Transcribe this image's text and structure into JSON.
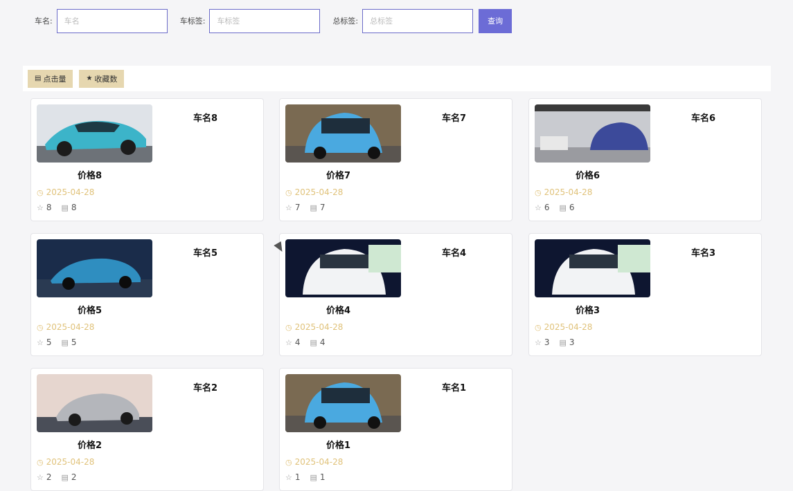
{
  "search": {
    "car_name_label": "车名:",
    "car_name_placeholder": "车名",
    "car_tag_label": "车标签:",
    "car_tag_placeholder": "车标签",
    "total_tag_label": "总标签:",
    "total_tag_placeholder": "总标签",
    "query_label": "查询"
  },
  "sort": {
    "clicks_label": "点击量",
    "favorites_label": "收藏数"
  },
  "cards": [
    {
      "name": "车名8",
      "price": "价格8",
      "date": "2025-04-28",
      "fav": "8",
      "clicks": "8",
      "img": "teal-sedan"
    },
    {
      "name": "车名7",
      "price": "价格7",
      "date": "2025-04-28",
      "fav": "7",
      "clicks": "7",
      "img": "blue-hatch"
    },
    {
      "name": "车名6",
      "price": "价格6",
      "date": "2025-04-28",
      "fav": "6",
      "clicks": "6",
      "img": "showroom-suv"
    },
    {
      "name": "车名5",
      "price": "价格5",
      "date": "2025-04-28",
      "fav": "5",
      "clicks": "5",
      "img": "blue-suv-night"
    },
    {
      "name": "车名4",
      "price": "价格4",
      "date": "2025-04-28",
      "fav": "4",
      "clicks": "4",
      "img": "white-ev"
    },
    {
      "name": "车名3",
      "price": "价格3",
      "date": "2025-04-28",
      "fav": "3",
      "clicks": "3",
      "img": "white-ev"
    },
    {
      "name": "车名2",
      "price": "价格2",
      "date": "2025-04-28",
      "fav": "2",
      "clicks": "2",
      "img": "silver-suv"
    },
    {
      "name": "车名1",
      "price": "价格1",
      "date": "2025-04-28",
      "fav": "1",
      "clicks": "1",
      "img": "blue-hatch"
    }
  ],
  "colors": {
    "accent": "#6c6cd6",
    "sort_button": "#e6d7b0",
    "date_text": "#e0c27a"
  }
}
